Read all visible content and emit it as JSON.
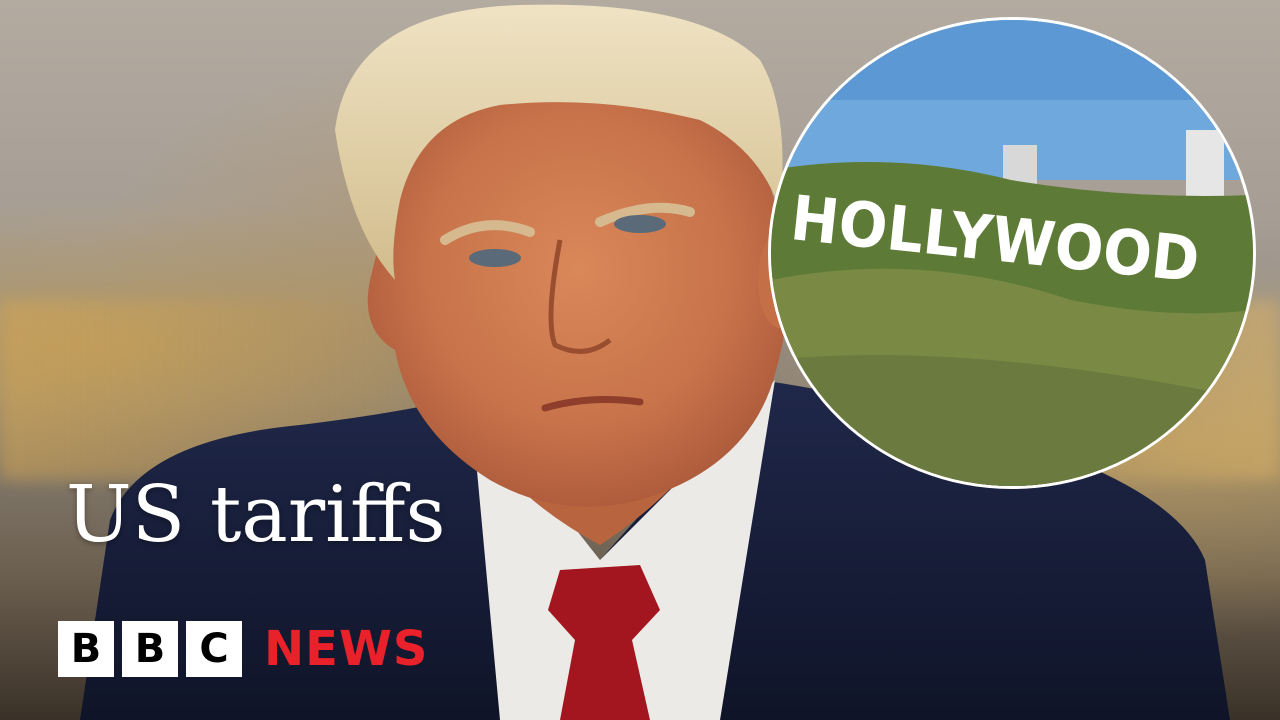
{
  "headline": "US tariffs",
  "inset": {
    "sign_text": "HOLLYWOOD"
  },
  "logo": {
    "letters": [
      "B",
      "B",
      "C"
    ],
    "news": "NEWS",
    "news_color": "#e8212a"
  }
}
